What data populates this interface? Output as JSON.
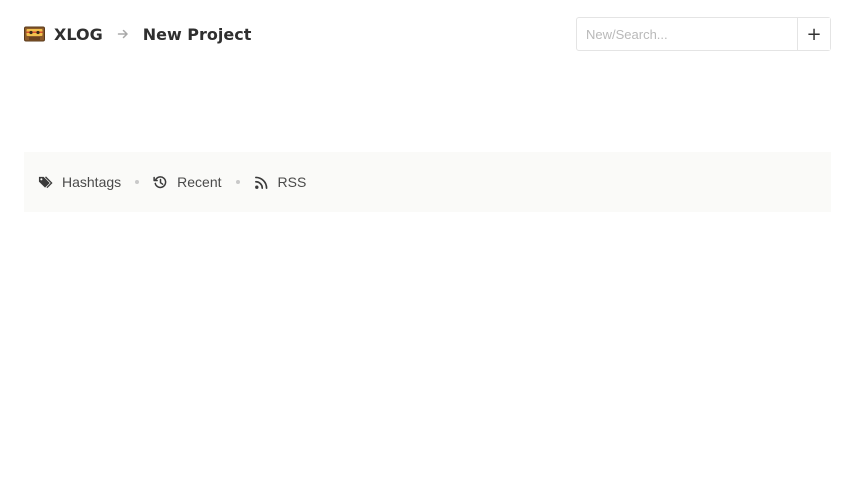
{
  "header": {
    "logo_icon": "cassette-tape-icon",
    "breadcrumb": [
      {
        "label": "XLOG"
      },
      {
        "label": "New Project"
      }
    ],
    "separator_icon": "arrow-right-icon"
  },
  "search": {
    "placeholder": "New/Search...",
    "value": "",
    "add_label": "+"
  },
  "nav": {
    "items": [
      {
        "label": "Hashtags",
        "icon": "tags-icon"
      },
      {
        "label": "Recent",
        "icon": "history-icon"
      },
      {
        "label": "RSS",
        "icon": "rss-icon"
      }
    ]
  },
  "colors": {
    "nav_background": "#fafaf8",
    "text": "#3b3b3b",
    "border": "#e4e4e4"
  }
}
